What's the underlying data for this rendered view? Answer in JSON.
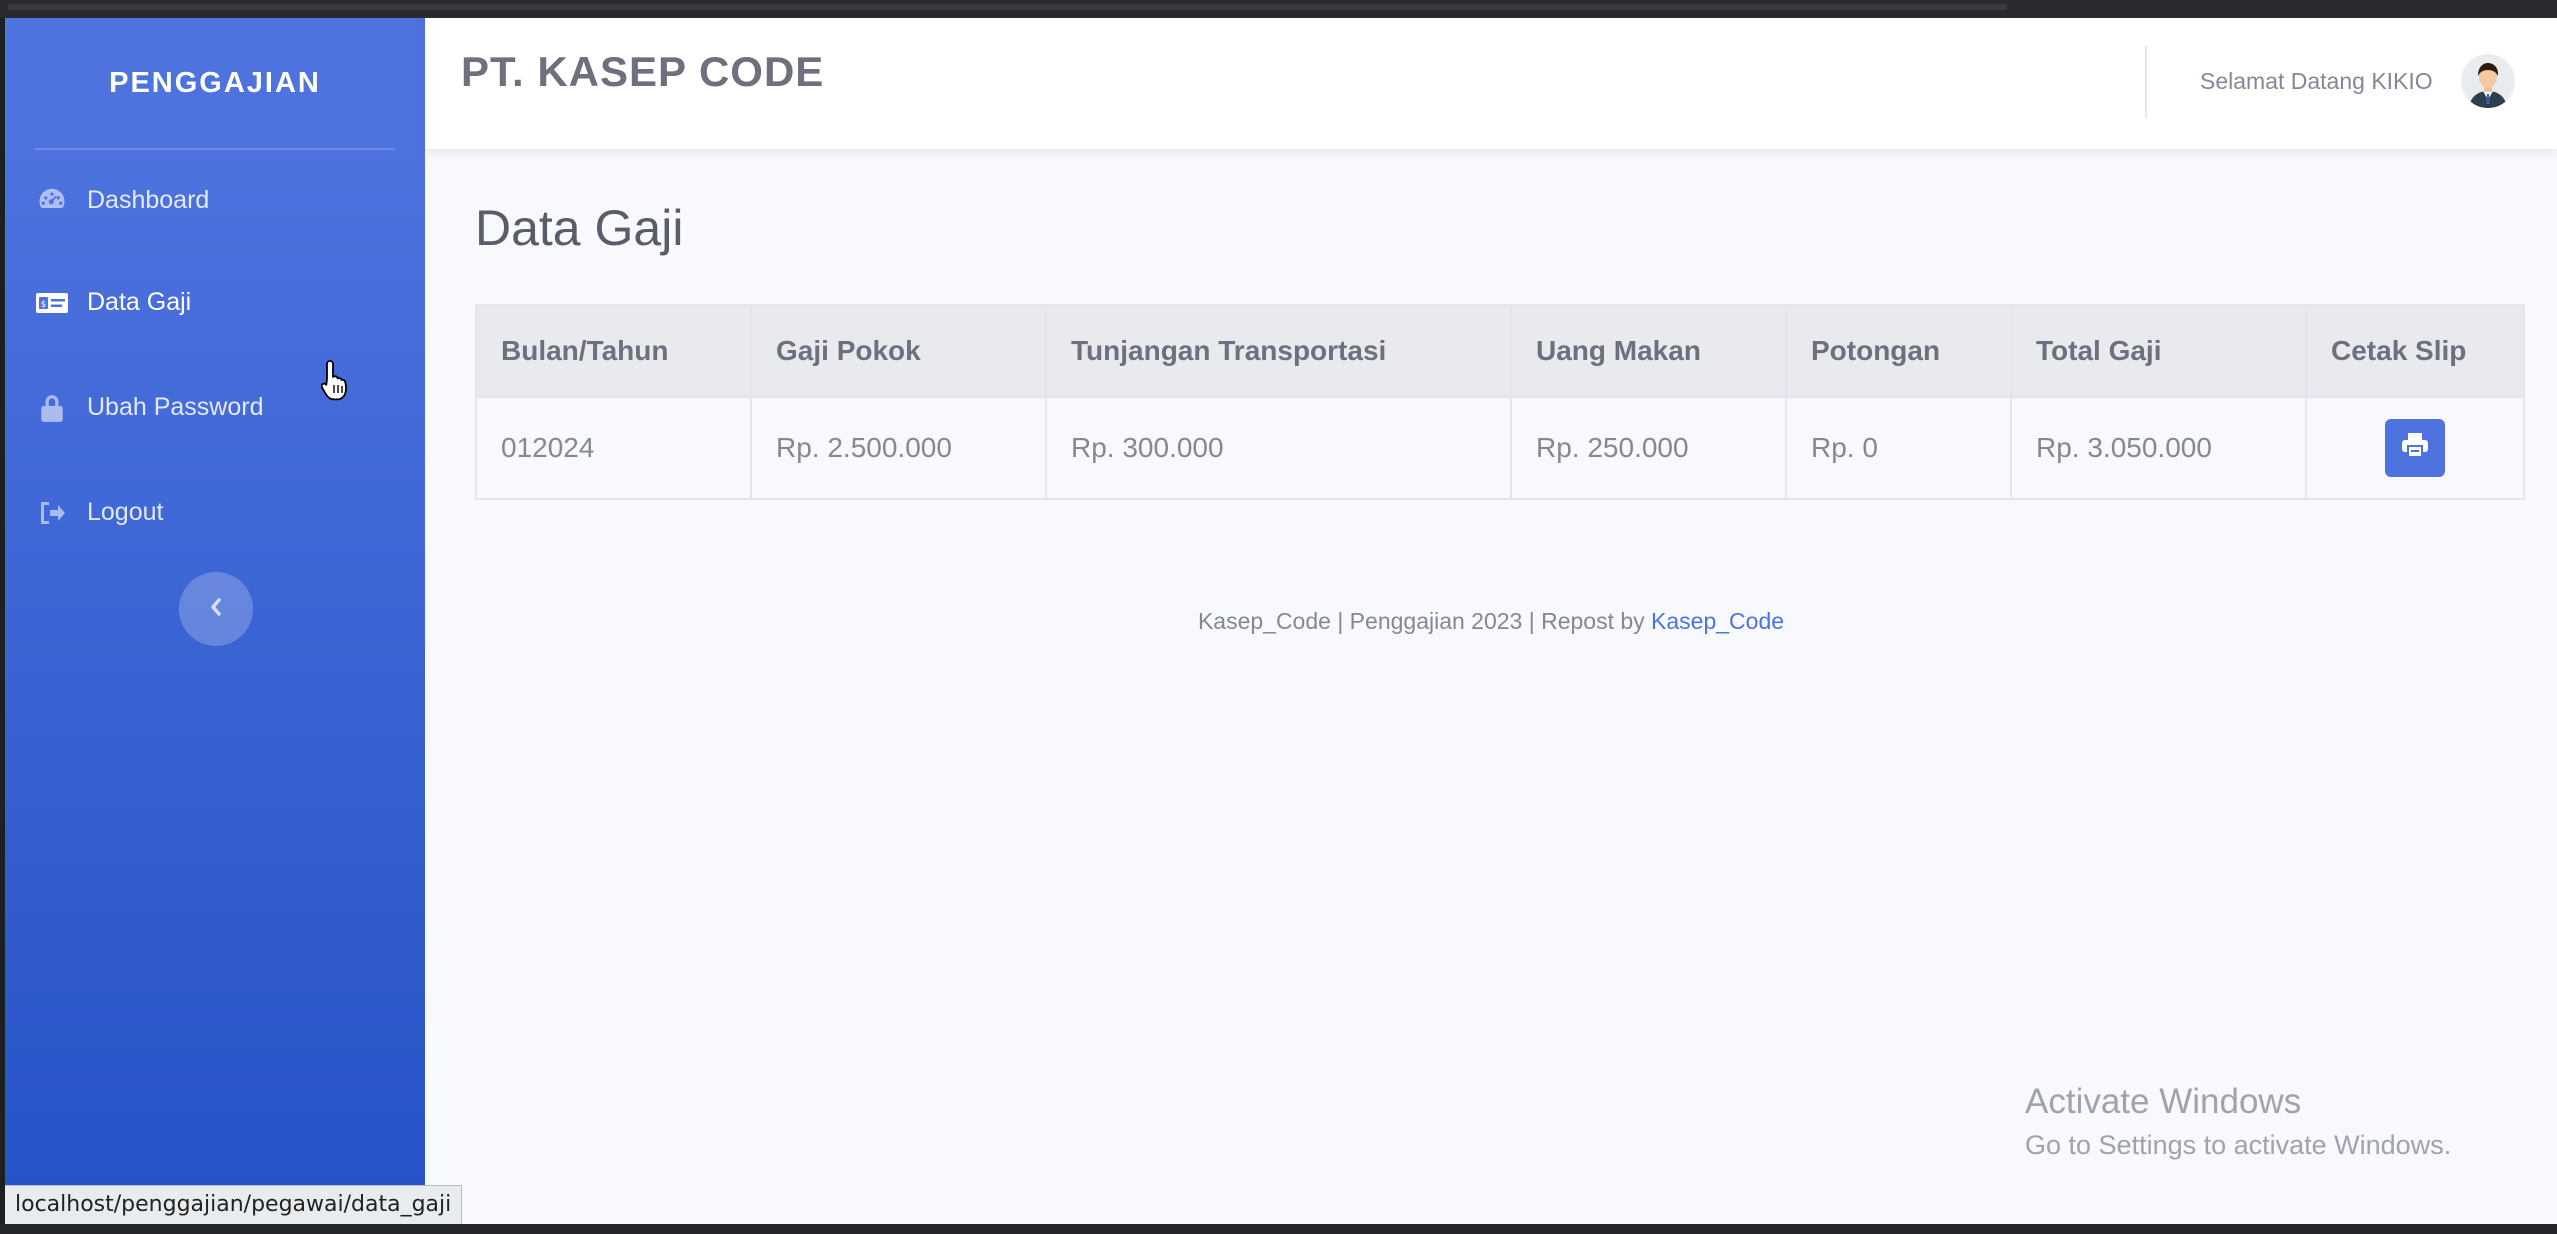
{
  "sidebar": {
    "brand": "PENGGAJIAN",
    "items": [
      {
        "label": "Dashboard",
        "icon": "tachometer-icon"
      },
      {
        "label": "Data Gaji",
        "icon": "money-bill-icon"
      },
      {
        "label": "Ubah Password",
        "icon": "lock-icon"
      },
      {
        "label": "Logout",
        "icon": "sign-out-icon"
      }
    ],
    "toggle_icon": "chevron-left-icon"
  },
  "topbar": {
    "company": "PT. KASEP CODE",
    "welcome": "Selamat Datang KIKIO",
    "avatar_icon": "user-avatar-icon"
  },
  "main": {
    "title": "Data Gaji",
    "table": {
      "headers": [
        "Bulan/Tahun",
        "Gaji Pokok",
        "Tunjangan Transportasi",
        "Uang Makan",
        "Potongan",
        "Total Gaji",
        "Cetak Slip"
      ],
      "rows": [
        [
          "012024",
          "Rp. 2.500.000",
          "Rp. 300.000",
          "Rp. 250.000",
          "Rp. 0",
          "Rp. 3.050.000"
        ]
      ],
      "print_icon": "print-icon"
    }
  },
  "footer": {
    "text": "Kasep_Code | Penggajian 2023 | Repost by ",
    "link": "Kasep_Code"
  },
  "status_url": "localhost/penggajian/pegawai/data_gaji",
  "watermark": {
    "title": "Activate Windows",
    "subtitle": "Go to Settings to activate Windows."
  },
  "colors": {
    "primary": "#4e73df",
    "sidebar_bottom": "#2652c6",
    "background": "#f8f9fc",
    "text_muted": "#858796"
  }
}
